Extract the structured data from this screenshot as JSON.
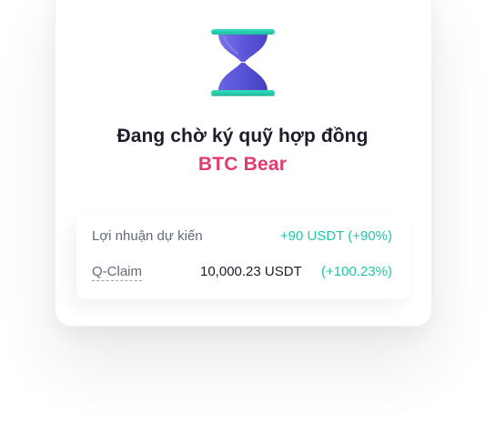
{
  "status": {
    "title": "Đang chờ ký quỹ hợp đồng",
    "contract_name": "BTC Bear",
    "icon": "hourglass-icon"
  },
  "details": {
    "expected_profit": {
      "label": "Lợi nhuận dự kiến",
      "value": "+90 USDT (+90%)"
    },
    "q_claim": {
      "label": "Q-Claim",
      "amount": "10,000.23 USDT",
      "percent": "(+100.23%)"
    }
  },
  "colors": {
    "accent_pink": "#e23b6f",
    "accent_green": "#1fc6a5",
    "hourglass_purple": "#5b55d8",
    "hourglass_teal": "#2fd3b4",
    "text_dark": "#1c1f2b",
    "text_muted": "#626a78"
  }
}
